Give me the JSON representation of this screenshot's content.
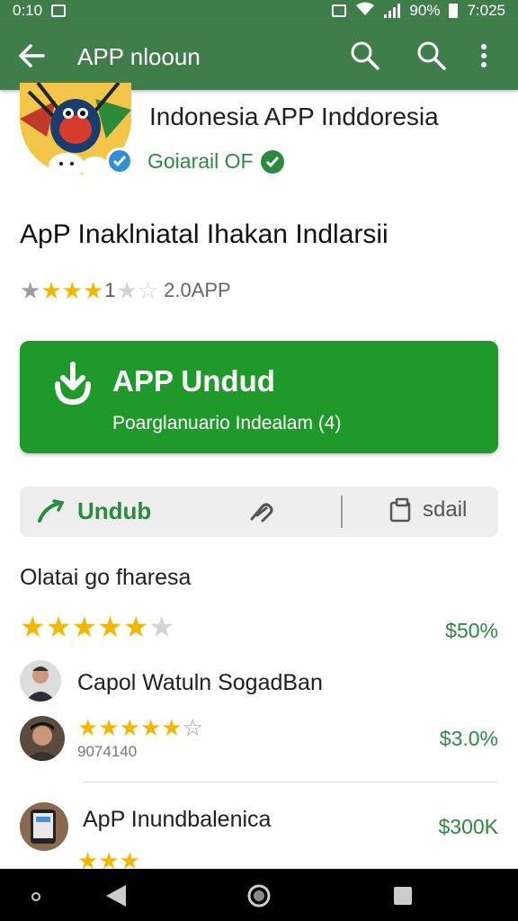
{
  "status": {
    "time_left": "0:10",
    "battery": "90%",
    "time_right": "7:025"
  },
  "appbar": {
    "title": "APP nlooun",
    "icons": [
      "back-arrow-icon",
      "search-icon",
      "search-icon",
      "more-vert-icon"
    ]
  },
  "app": {
    "name": "Indonesia APP Inddoresia",
    "developer": "Goiarail OF"
  },
  "headline": "ApP Inaklniatal Ihakan Indlarsii",
  "rating": {
    "value": "1",
    "count": "2.0APP"
  },
  "install": {
    "label": "APP Undud",
    "sub": "Poarglanuario Indealam (4)"
  },
  "actions": {
    "primary": "Undub",
    "secondary": "sdail"
  },
  "section": {
    "title": "Olatai go fharesa",
    "summary_price": "$50%"
  },
  "reviews": [
    {
      "name": "Capol Watuln SogadBan",
      "meta": "9074140",
      "price": "$3.0%"
    },
    {
      "name": "ApP Inundbalenica",
      "price": "$300K"
    }
  ],
  "colors": {
    "appbar": "#3f7d4a",
    "accent_green": "#2b8a3e",
    "button_green": "#1f9a2a",
    "star": "#f2b705"
  }
}
